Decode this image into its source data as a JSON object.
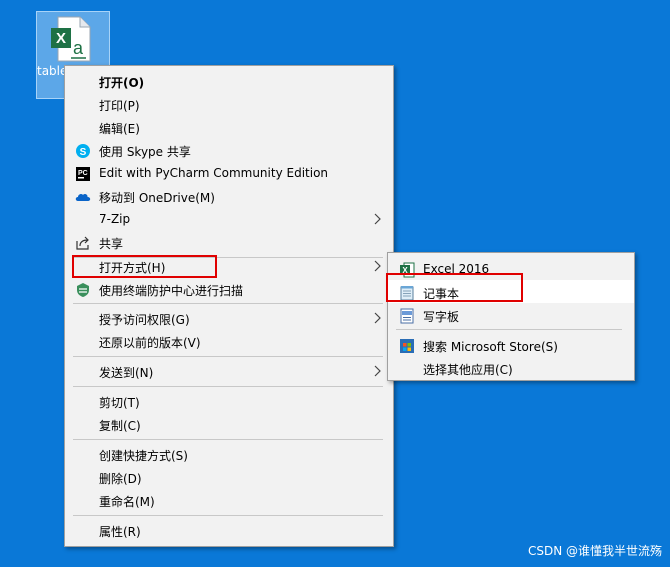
{
  "desktop_icon": {
    "label": "table",
    "icon": "excel-file-icon"
  },
  "context_menu": {
    "items": [
      {
        "label": "打开(O)",
        "bold": true
      },
      {
        "label": "打印(P)"
      },
      {
        "label": "编辑(E)"
      },
      {
        "label": "使用 Skype 共享",
        "icon": "skype-icon"
      },
      {
        "label": "Edit with PyCharm Community Edition",
        "icon": "pycharm-icon"
      },
      {
        "label": "移动到 OneDrive(M)",
        "icon": "onedrive-cloud-icon"
      },
      {
        "label": "7-Zip",
        "submenu": true
      },
      {
        "label": "共享",
        "icon": "share-icon"
      },
      {
        "label": "打开方式(H)",
        "submenu": true,
        "highlighted": true
      },
      {
        "label": "使用终端防护中心进行扫描",
        "icon": "shield-scan-icon"
      },
      {
        "label": "授予访问权限(G)",
        "submenu": true
      },
      {
        "label": "还原以前的版本(V)"
      },
      {
        "label": "发送到(N)",
        "submenu": true
      },
      {
        "label": "剪切(T)"
      },
      {
        "label": "复制(C)"
      },
      {
        "label": "创建快捷方式(S)"
      },
      {
        "label": "删除(D)"
      },
      {
        "label": "重命名(M)"
      },
      {
        "label": "属性(R)"
      }
    ]
  },
  "open_with_submenu": {
    "items": [
      {
        "label": "Excel 2016",
        "icon": "excel-icon"
      },
      {
        "label": "记事本",
        "icon": "notepad-icon",
        "highlighted": true
      },
      {
        "label": "写字板",
        "icon": "wordpad-icon"
      },
      {
        "label": "搜索 Microsoft Store(S)",
        "icon": "store-icon"
      },
      {
        "label": "选择其他应用(C)"
      }
    ]
  },
  "watermark": "CSDN @谁懂我半世流殇",
  "colors": {
    "desktop": "#0a78d7",
    "menu_bg": "#f2f2f2",
    "annotation": "#e00000"
  }
}
